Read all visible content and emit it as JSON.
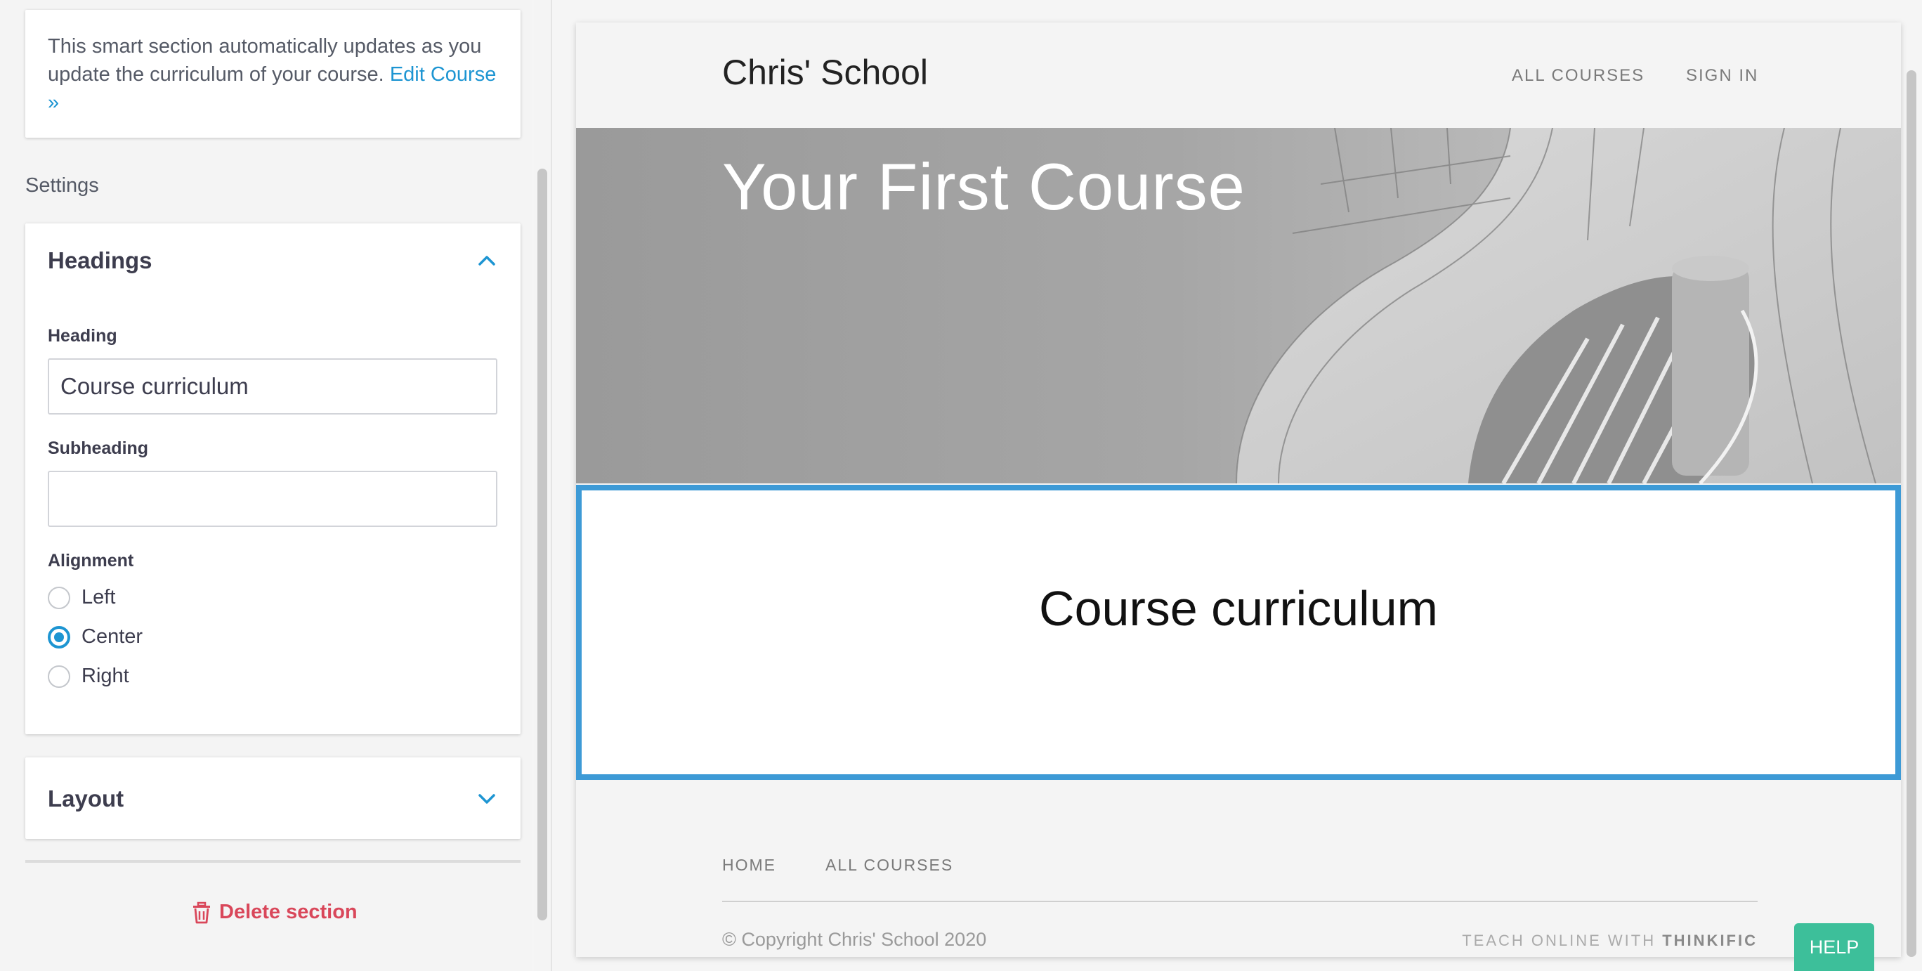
{
  "sidebar": {
    "info_text": "This smart section automatically updates as you update the curriculum of your course.",
    "info_link": "Edit Course »",
    "settings_label": "Settings",
    "headings_panel": {
      "title": "Headings",
      "heading_label": "Heading",
      "heading_value": "Course curriculum",
      "subheading_label": "Subheading",
      "subheading_value": "",
      "alignment_label": "Alignment",
      "alignment_options": [
        "Left",
        "Center",
        "Right"
      ],
      "alignment_selected": "Center"
    },
    "layout_panel": {
      "title": "Layout"
    },
    "delete_label": "Delete section"
  },
  "preview": {
    "school_name": "Chris' School",
    "nav": [
      "ALL COURSES",
      "SIGN IN"
    ],
    "course_title": "Your First Course",
    "curriculum_heading": "Course curriculum",
    "footer_links": [
      "HOME",
      "ALL COURSES"
    ],
    "copyright": "© Copyright Chris' School 2020",
    "teach_online_prefix": "TEACH ONLINE WITH",
    "teach_online_brand": "THINKIFIC"
  },
  "help_label": "HELP",
  "colors": {
    "accent": "#1d95d2",
    "selection_border": "#3d9ad6",
    "danger": "#d9475a",
    "help": "#3dbf9a"
  },
  "icons": {
    "headings_toggle": "chevron-up-icon",
    "layout_toggle": "chevron-down-icon",
    "delete": "trash-icon"
  }
}
